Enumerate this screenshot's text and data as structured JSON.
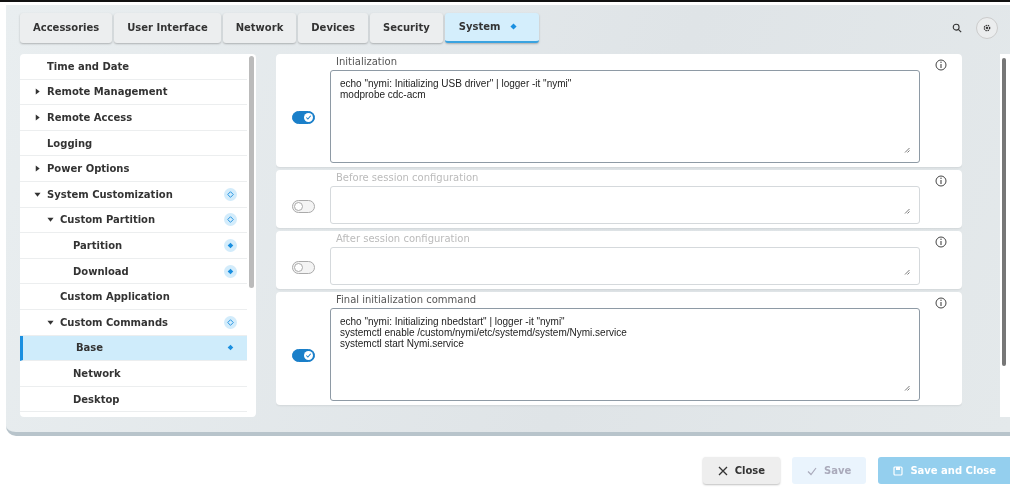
{
  "tabs": [
    {
      "label": "Accessories",
      "selected": false,
      "modified": false
    },
    {
      "label": "User Interface",
      "selected": false,
      "modified": false
    },
    {
      "label": "Network",
      "selected": false,
      "modified": false
    },
    {
      "label": "Devices",
      "selected": false,
      "modified": false
    },
    {
      "label": "Security",
      "selected": false,
      "modified": false
    },
    {
      "label": "System",
      "selected": true,
      "modified": true
    }
  ],
  "sidebar": {
    "items": [
      {
        "label": "Time and Date",
        "selected": false
      },
      {
        "label": "Remote Management",
        "selected": false,
        "expanded": false
      },
      {
        "label": "Remote Access",
        "selected": false,
        "expanded": false
      },
      {
        "label": "Logging",
        "selected": false
      },
      {
        "label": "Power Options",
        "selected": false,
        "expanded": false
      },
      {
        "label": "System Customization",
        "selected": false,
        "expanded": true,
        "kind": "partial",
        "children": [
          {
            "label": "Custom Partition",
            "selected": false,
            "expanded": true,
            "kind": "partial",
            "children": [
              {
                "label": "Partition",
                "selected": false,
                "kind": "full"
              },
              {
                "label": "Download",
                "selected": false,
                "kind": "full"
              }
            ]
          },
          {
            "label": "Custom Application",
            "selected": false
          },
          {
            "label": "Custom Commands",
            "selected": false,
            "expanded": true,
            "kind": "partial",
            "children": [
              {
                "label": "Base",
                "selected": true,
                "kind": "full"
              },
              {
                "label": "Network",
                "selected": false
              },
              {
                "label": "Desktop",
                "selected": false
              }
            ]
          }
        ]
      }
    ]
  },
  "sections": [
    {
      "label": "Initialization",
      "enabled": true,
      "lines": [
        "echo \"nymi: Initializing USB driver\" | logger -it \"nymi\"",
        "modprobe cdc-acm"
      ]
    },
    {
      "label": "Before session configuration",
      "enabled": false
    },
    {
      "label": "After session configuration",
      "enabled": false
    },
    {
      "label": "Final initialization command",
      "enabled": true,
      "lines": [
        "echo \"nymi: Initializing nbedstart\" | logger -it \"nymi\"",
        "systemctl enable /custom/nymi/etc/systemd/system/Nymi.service",
        "systemctl start Nymi.service"
      ]
    }
  ],
  "buttons": [
    {
      "label": "Close",
      "kind": "close",
      "disabled": false
    },
    {
      "label": "Save",
      "kind": "save",
      "disabled": true
    },
    {
      "label": "Save and Close",
      "kind": "save-close",
      "disabled": true
    }
  ]
}
